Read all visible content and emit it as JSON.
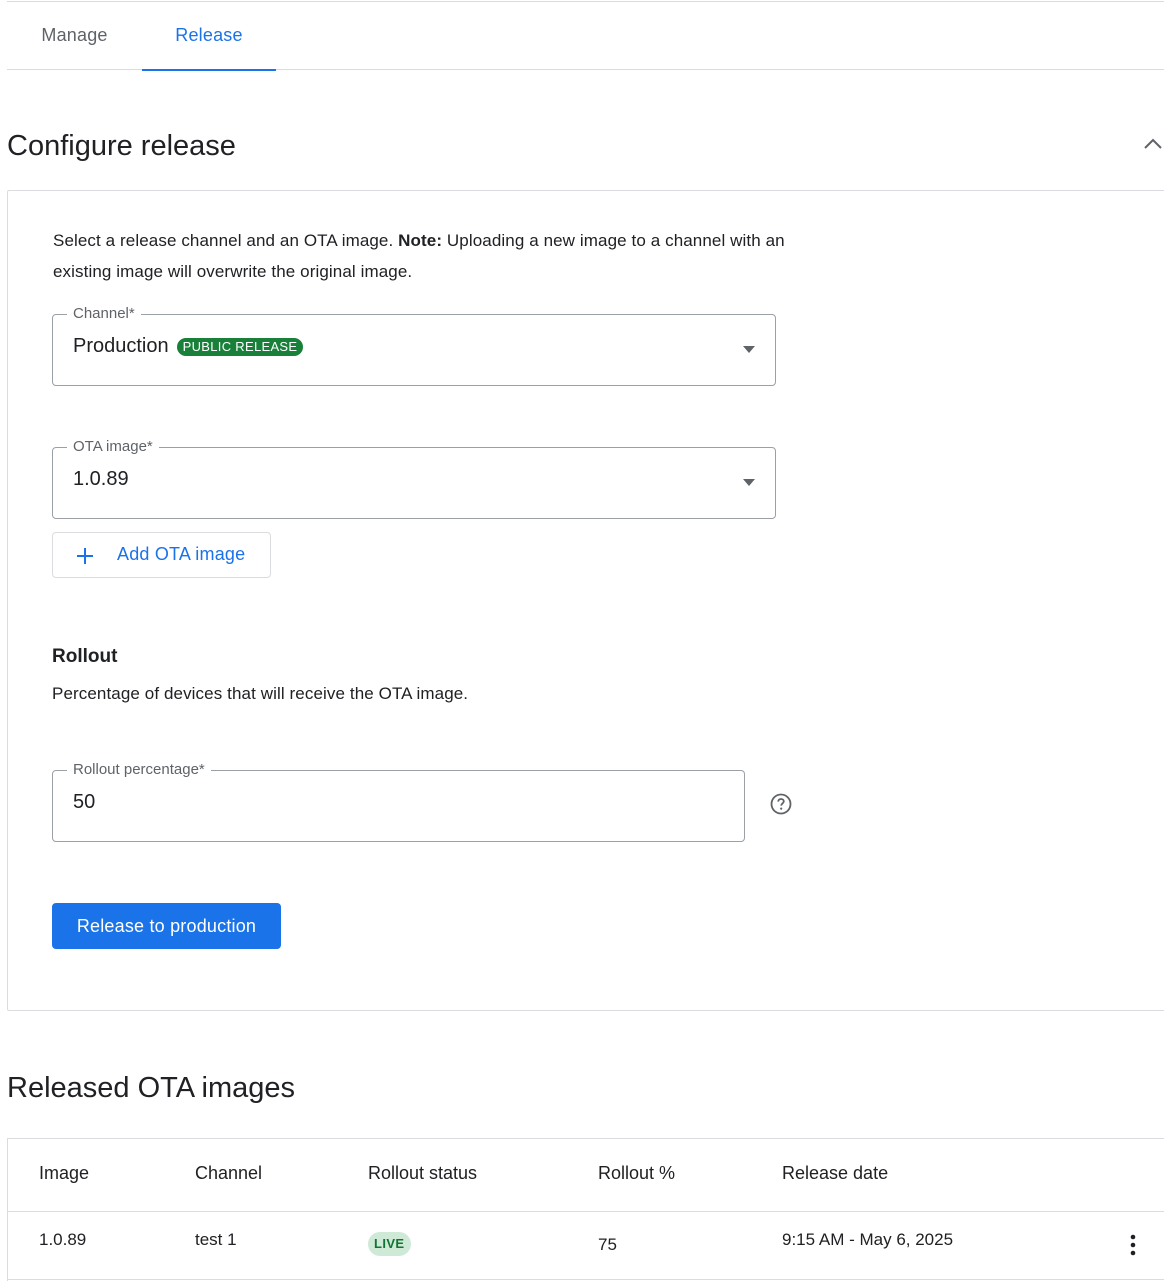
{
  "tabs": [
    {
      "label": "Manage",
      "active": false
    },
    {
      "label": "Release",
      "active": true
    }
  ],
  "configure": {
    "title": "Configure release",
    "collapse_icon": "chevron-up-icon",
    "description_prefix": "Select a release channel and an OTA image. ",
    "description_note_label": "Note:",
    "description_suffix": " Uploading a new image to a channel with an existing image will overwrite the original image.",
    "channel": {
      "label": "Channel*",
      "value": "Production",
      "badge": "PUBLIC RELEASE",
      "badge_color": "#188038"
    },
    "ota_image": {
      "label": "OTA image*",
      "value": "1.0.89"
    },
    "add_ota_button": "Add OTA image",
    "rollout": {
      "heading": "Rollout",
      "description": "Percentage of devices that will receive the OTA image.",
      "field_label": "Rollout percentage*",
      "value": "50",
      "help_icon": "help-circle-icon"
    },
    "release_button": "Release to production"
  },
  "released": {
    "title": "Released OTA images",
    "columns": [
      "Image",
      "Channel",
      "Rollout status",
      "Rollout %",
      "Release date"
    ],
    "rows": [
      {
        "image": "1.0.89",
        "channel": "test 1",
        "status": "LIVE",
        "rollout_pct": "75",
        "release_date": "9:15 AM - May 6, 2025"
      }
    ]
  },
  "colors": {
    "accent": "#1a73e8",
    "public_badge": "#188038",
    "live_badge_bg": "#ceead6",
    "live_badge_text": "#137333"
  }
}
